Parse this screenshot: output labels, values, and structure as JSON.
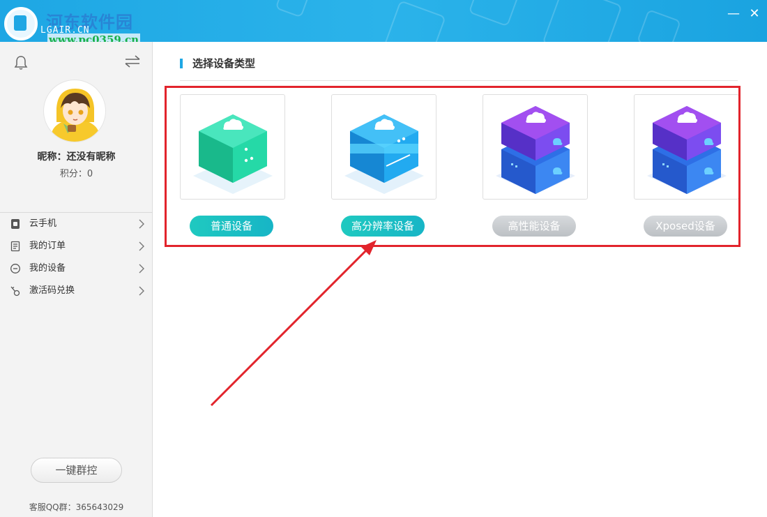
{
  "watermark": {
    "site_name_cn": "河东软件园",
    "site_name_en": "LGAIR.CN",
    "url": "www.pc0359.cn"
  },
  "window": {
    "minimize": "—",
    "close": "✕"
  },
  "sidebar": {
    "profile": {
      "nickname_label": "昵称：还没有昵称",
      "points_label": "积分：0"
    },
    "menu": [
      {
        "label": "云手机",
        "icon": "phone-icon"
      },
      {
        "label": "我的订单",
        "icon": "order-icon"
      },
      {
        "label": "我的设备",
        "icon": "device-icon"
      },
      {
        "label": "激活码兑换",
        "icon": "key-icon"
      }
    ],
    "onekey_button": "一键群控",
    "support": {
      "label": "客服QQ群：",
      "number": "365643029"
    }
  },
  "main": {
    "section_title": "选择设备类型",
    "device_types": [
      {
        "label": "普通设备",
        "state": "active",
        "icon": "server-cloud-green-icon"
      },
      {
        "label": "高分辨率设备",
        "state": "active",
        "icon": "server-cloud-blue-icon"
      },
      {
        "label": "高性能设备",
        "state": "inactive",
        "icon": "server-cloud-purple-icon"
      },
      {
        "label": "Xposed设备",
        "state": "inactive",
        "icon": "server-cloud-purple-icon"
      }
    ]
  },
  "colors": {
    "titlebar": "#1ea7e4",
    "accent": "#1ea7e4",
    "button_active": "#1fc9c0",
    "button_inactive": "#c5c9cd",
    "annotation_red": "#e2242c"
  }
}
